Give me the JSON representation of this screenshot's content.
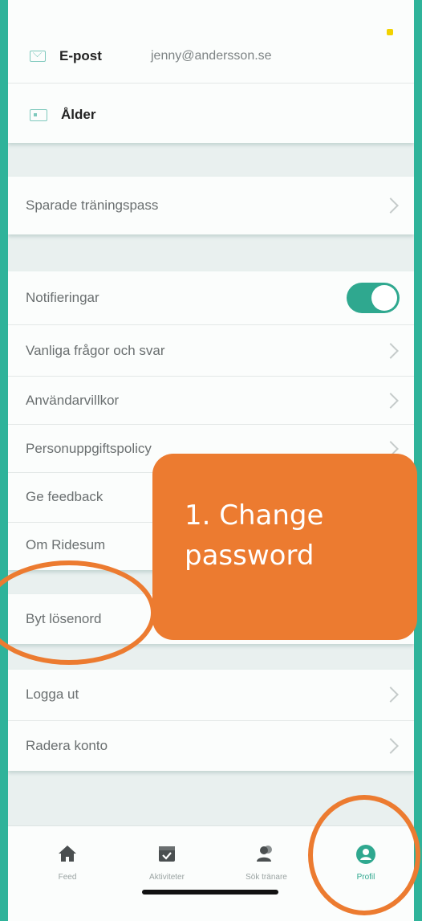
{
  "profile_card": {
    "email_label": "E-post",
    "email_value": "jenny@andersson.se",
    "age_label": "Ålder"
  },
  "saved": {
    "label": "Sparade träningspass"
  },
  "settings": {
    "notifications_label": "Notifieringar",
    "notifications_on": true,
    "items": [
      {
        "label": "Vanliga frågor och svar"
      },
      {
        "label": "Användarvillkor"
      },
      {
        "label": "Personuppgiftspolicy"
      },
      {
        "label": "Ge feedback"
      },
      {
        "label": "Om Ridesum"
      }
    ]
  },
  "password": {
    "label": "Byt lösenord"
  },
  "account": {
    "items": [
      {
        "label": "Logga ut"
      },
      {
        "label": "Radera konto"
      }
    ]
  },
  "callout": {
    "text": "1. Change password"
  },
  "tabbar": {
    "tabs": [
      {
        "label": "Feed",
        "icon": "home-icon"
      },
      {
        "label": "Aktiviteter",
        "icon": "calendar-check-icon"
      },
      {
        "label": "Sök tränare",
        "icon": "users-icon"
      },
      {
        "label": "Profil",
        "icon": "profile-icon",
        "active": true
      }
    ]
  },
  "colors": {
    "accent": "#2fa88f",
    "annotation": "#ec7b30"
  }
}
